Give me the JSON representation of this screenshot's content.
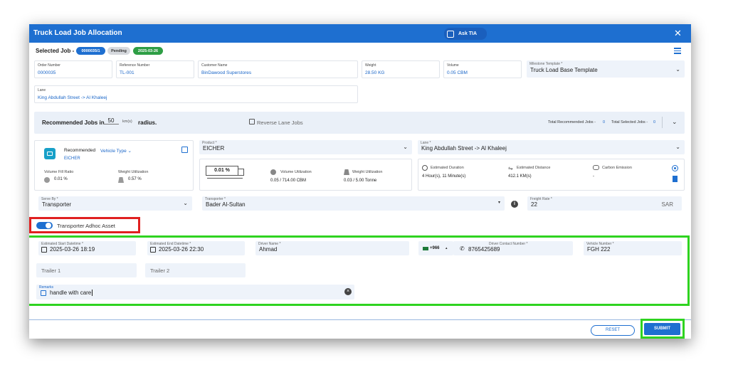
{
  "window": {
    "title": "Truck Load Job Allocation",
    "ask_label": "Ask TIA",
    "close_label": "✕"
  },
  "selected_job": {
    "label": "Selected Job -",
    "job_id": "0000035/1",
    "status": "Pending",
    "date": "2025-03-26"
  },
  "fields": {
    "order_number": {
      "label": "Order Number",
      "value": "0000035"
    },
    "reference_number": {
      "label": "Reference Number",
      "value": "TL-001"
    },
    "customer_name": {
      "label": "Customer Name",
      "value": "BinDawood Superstores"
    },
    "weight": {
      "label": "Weight",
      "value": "28.50 KG"
    },
    "volume": {
      "label": "Volume",
      "value": "0.05 CBM"
    },
    "milestone_template": {
      "label": "Milestone Template *",
      "value": "Truck Load Base Template"
    },
    "lane": {
      "label": "Lane",
      "value": "King Abdullah Street -> Al Khaleej"
    }
  },
  "recommended_bar": {
    "prefix": "Recommended Jobs in",
    "radius": "50",
    "unit": "km(s)",
    "suffix": "radius.",
    "reverse_label": "Reverse Lane Jobs",
    "total_recommended_label": "Total Recommended Jobs -",
    "total_recommended": "0",
    "total_selected_label": "Total Selected Jobs -",
    "total_selected": "0"
  },
  "vehicle": {
    "recommended_label": "Recommended",
    "type_link": "Vehicle Type",
    "type_value": "EICHER",
    "fill_ratio_label": "Volume Fill Ratio",
    "fill_ratio": "0.01 %",
    "weight_util_label": "Weight Utilization",
    "weight_util": "0.57 %"
  },
  "product": {
    "label": "Product *",
    "value": "EICHER"
  },
  "lane_select": {
    "label": "Lane *",
    "value": "King Abdullah Street -> Al Khaleej"
  },
  "utilization": {
    "percent": "0.01 %",
    "percent_fill": 0.01,
    "volume_label": "Volume Utilization",
    "volume_value": "0.05 / 714.00 CBM",
    "weight_label": "Weight Utilization",
    "weight_value": "0.03 / 5.00 Tonne"
  },
  "estimates": {
    "duration_label": "Estimated Duration",
    "duration": "4 Hour(s), 11 Minute(s)",
    "distance_label": "Estimated Distance",
    "distance": "412.1 KM(s)",
    "emission_label": "Carbon Emission",
    "emission": "-"
  },
  "serve_by": {
    "label": "Serve By *",
    "value": "Transporter"
  },
  "transporter": {
    "label": "Transporter *",
    "value": "Bader Al-Sultan"
  },
  "freight": {
    "label": "Freight Rate *",
    "value": "22",
    "currency": "SAR"
  },
  "adhoc": {
    "label": "Transporter Adhoc Asset",
    "enabled": true
  },
  "assignment": {
    "start_label": "Estimated Start Datetime *",
    "start": "2025-03-26 18:19",
    "end_label": "Estimated End Datetime *",
    "end": "2025-03-26 22:30",
    "driver_label": "Driver Name *",
    "driver": "Ahmad",
    "country_code": "+966",
    "contact_label": "Driver Contact Number *",
    "contact": "8765425689",
    "vehicle_label": "Vehicle Number *",
    "vehicle": "FGH 222",
    "trailer1_placeholder": "Trailer 1",
    "trailer2_placeholder": "Trailer 2",
    "remarks_label": "Remarks",
    "remarks": "handle with care"
  },
  "footer": {
    "reset": "RESET",
    "submit": "SUBMIT"
  },
  "colors": {
    "primary": "#1e6fd0",
    "pending": "#d0d4da",
    "date_pill": "#2e9e45",
    "highlight_red": "#e02020",
    "highlight_green": "#2fd320"
  }
}
